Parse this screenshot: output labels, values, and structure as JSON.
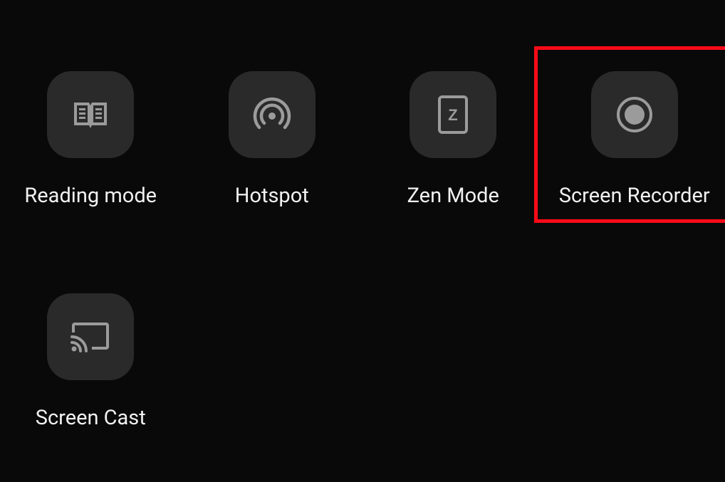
{
  "tiles": [
    {
      "label": "Reading mode",
      "icon": "reading-mode-icon"
    },
    {
      "label": "Hotspot",
      "icon": "hotspot-icon"
    },
    {
      "label": "Zen Mode",
      "icon": "zen-mode-icon"
    },
    {
      "label": "Screen Recorder",
      "icon": "screen-recorder-icon",
      "highlighted": true
    },
    {
      "label": "Screen Cast",
      "icon": "screen-cast-icon"
    }
  ],
  "colors": {
    "background": "#090909",
    "tile": "#2a2a2a",
    "icon": "#9b9b9b",
    "text": "#f1f1f1",
    "highlight": "#ff0a18"
  }
}
